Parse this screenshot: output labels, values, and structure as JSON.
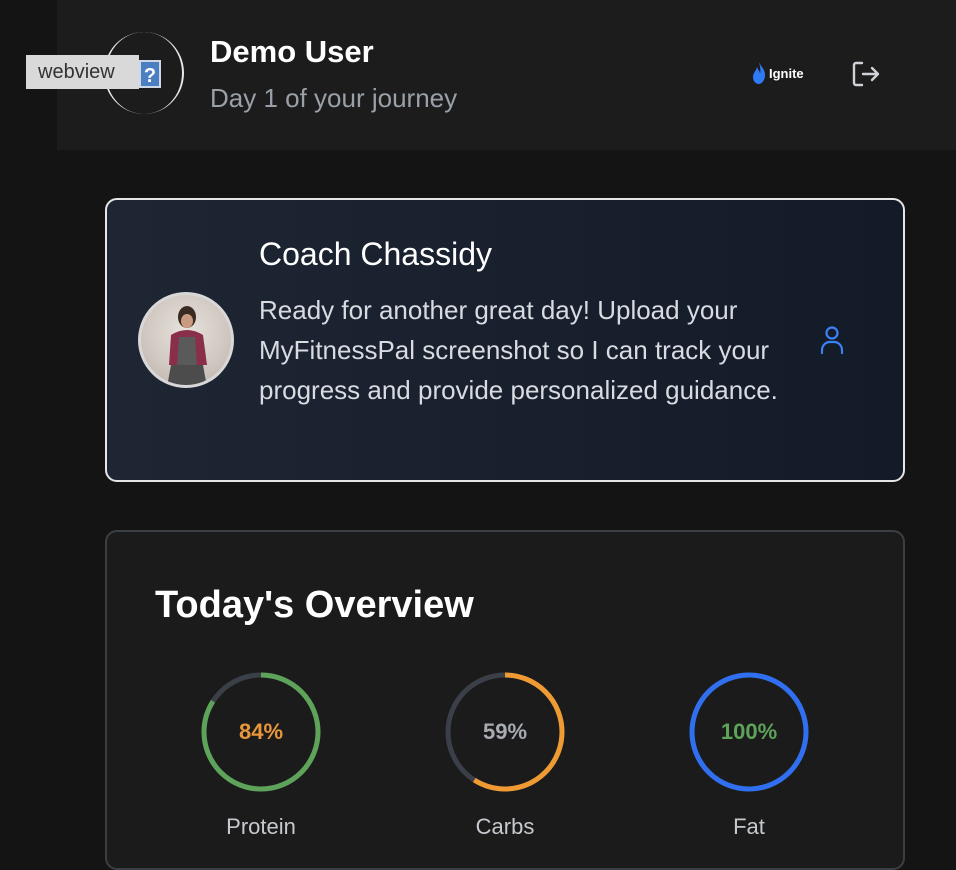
{
  "header": {
    "webview_label": "webview",
    "broken_image_glyph": "?",
    "user_name": "Demo User",
    "user_subtitle": "Day 1 of your journey",
    "brand_name": "Ignite",
    "logout_icon": "logout-icon"
  },
  "coach": {
    "name": "Coach Chassidy",
    "message": "Ready for another great day! Upload your MyFitnessPal screenshot so I can track your progress and provide personalized guidance.",
    "profile_icon": "person-icon"
  },
  "overview": {
    "title": "Today's Overview",
    "macros": [
      {
        "label": "Protein",
        "percent_text": "84%",
        "fraction": 0.84,
        "ring_color": "#5ea35a",
        "track_color": "#3a3f48",
        "text_color": "#e8963a"
      },
      {
        "label": "Carbs",
        "percent_text": "59%",
        "fraction": 0.59,
        "ring_color": "#f09a34",
        "track_color": "#3a3f48",
        "text_color": "#a7abb2"
      },
      {
        "label": "Fat",
        "percent_text": "100%",
        "fraction": 1.0,
        "ring_color": "#2f6ff0",
        "track_color": "#3a3f48",
        "text_color": "#5ea35a"
      }
    ]
  },
  "colors": {
    "background": "#141414",
    "accent_blue": "#3b82f6",
    "protein_ring": "#5ea35a"
  }
}
